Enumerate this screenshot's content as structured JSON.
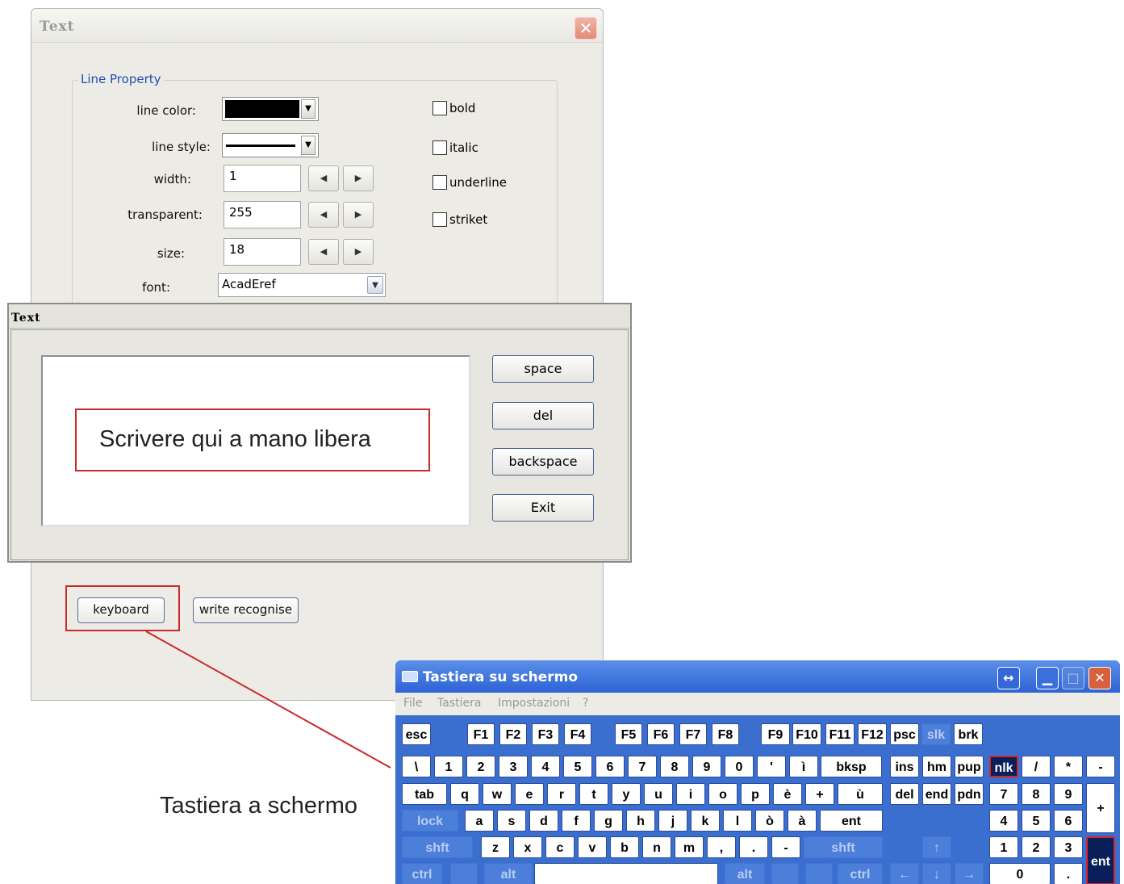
{
  "dialog_back": {
    "title": "Text",
    "close_glyph": "✕",
    "group_title": "Line Property",
    "line_color_label": "line color:",
    "line_style_label": "line style:",
    "width_label": "width:",
    "width_value": "1",
    "transparent_label": "transparent:",
    "transparent_value": "255",
    "size_label": "size:",
    "size_value": "18",
    "font_label": "font:",
    "font_value": "AcadEref",
    "bold": "bold",
    "italic": "italic",
    "underline": "underline",
    "striket": "striket",
    "keyboard_button": "keyboard",
    "write_recognise_button": "write recognise",
    "line_color_value": "#000000"
  },
  "dialog_front": {
    "title": "Text",
    "space_button": "space",
    "del_button": "del",
    "backspace_button": "backspace",
    "exit_button": "Exit"
  },
  "annotations": {
    "writing_area": "Scrivere qui a mano libera",
    "keyboard_caption": "Tastiera a schermo",
    "highlight_color": "#cc2a2a"
  },
  "osk": {
    "title": "Tastiera su schermo",
    "menu": [
      "File",
      "Tastiera",
      "Impostazioni",
      "?"
    ],
    "row0": [
      "esc",
      "F1",
      "F2",
      "F3",
      "F4",
      "F5",
      "F6",
      "F7",
      "F8",
      "F9",
      "F10",
      "F11",
      "F12",
      "psc",
      "slk",
      "brk"
    ],
    "row1": [
      "\\",
      "1",
      "2",
      "3",
      "4",
      "5",
      "6",
      "7",
      "8",
      "9",
      "0",
      "'",
      "ì",
      "bksp",
      "ins",
      "hm",
      "pup",
      "nlk",
      "/",
      "*",
      "-"
    ],
    "row2": [
      "tab",
      "q",
      "w",
      "e",
      "r",
      "t",
      "y",
      "u",
      "i",
      "o",
      "p",
      "è",
      "+",
      "ù",
      "del",
      "end",
      "pdn",
      "7",
      "8",
      "9",
      "+"
    ],
    "row3": [
      "lock",
      "a",
      "s",
      "d",
      "f",
      "g",
      "h",
      "j",
      "k",
      "l",
      "ò",
      "à",
      "ent",
      "4",
      "5",
      "6"
    ],
    "row4": [
      "shft",
      "z",
      "x",
      "c",
      "v",
      "b",
      "n",
      "m",
      ",",
      ".",
      "-",
      "shft",
      "↑",
      "1",
      "2",
      "3",
      "ent"
    ],
    "row5": [
      "ctrl",
      "alt",
      "alt",
      "ctrl",
      "←",
      "↓",
      "→",
      "0",
      "."
    ],
    "accent_color": "#3a6fd0"
  }
}
